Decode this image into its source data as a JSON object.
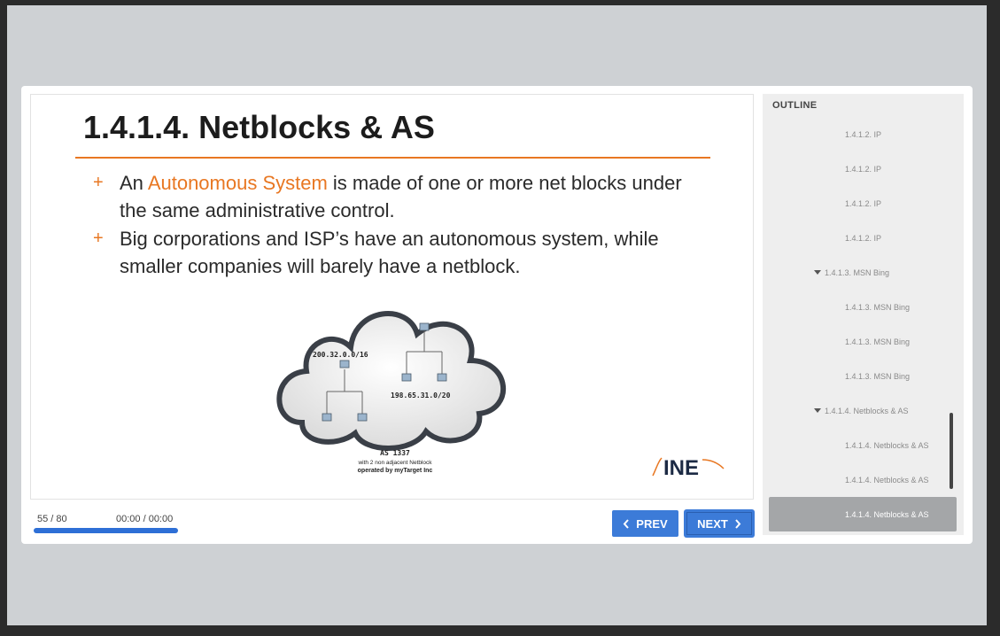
{
  "slide": {
    "title": "1.4.1.4. Netblocks & AS",
    "bullet1_pre": "An ",
    "bullet1_hl": "Autonomous System",
    "bullet1_post": " is made of one or more net blocks under the same administrative control.",
    "bullet2": "Big corporations and ISP’s have an autonomous system, while smaller companies will barely have a netblock.",
    "diagram": {
      "net1": "200.32.0.0/16",
      "net2": "198.65.31.0/20",
      "as_label": "AS 1337",
      "as_sub1": "with 2 non adjacent Netblock",
      "as_sub2": "operated by myTarget Inc"
    },
    "logo_text": "INE"
  },
  "controls": {
    "counter": "55 / 80",
    "time": "00:00 / 00:00",
    "progress_fraction": 1.0,
    "prev_label": "PREV",
    "next_label": "NEXT"
  },
  "outline": {
    "heading": "OUTLINE",
    "items": [
      {
        "label": "1.4.1.2. IP",
        "kind": "child"
      },
      {
        "label": "1.4.1.2. IP",
        "kind": "child"
      },
      {
        "label": "1.4.1.2. IP",
        "kind": "child"
      },
      {
        "label": "1.4.1.2. IP",
        "kind": "child"
      },
      {
        "label": "1.4.1.3. MSN Bing",
        "kind": "parent"
      },
      {
        "label": "1.4.1.3. MSN Bing",
        "kind": "child"
      },
      {
        "label": "1.4.1.3. MSN Bing",
        "kind": "child"
      },
      {
        "label": "1.4.1.3. MSN Bing",
        "kind": "child"
      },
      {
        "label": "1.4.1.4. Netblocks & AS",
        "kind": "parent"
      },
      {
        "label": "1.4.1.4. Netblocks & AS",
        "kind": "child"
      },
      {
        "label": "1.4.1.4. Netblocks & AS",
        "kind": "child"
      },
      {
        "label": "1.4.1.4. Netblocks & AS",
        "kind": "active"
      }
    ]
  },
  "colors": {
    "accent": "#e87722",
    "button": "#3c7bd8",
    "outline_active": "#a4a6a8"
  }
}
